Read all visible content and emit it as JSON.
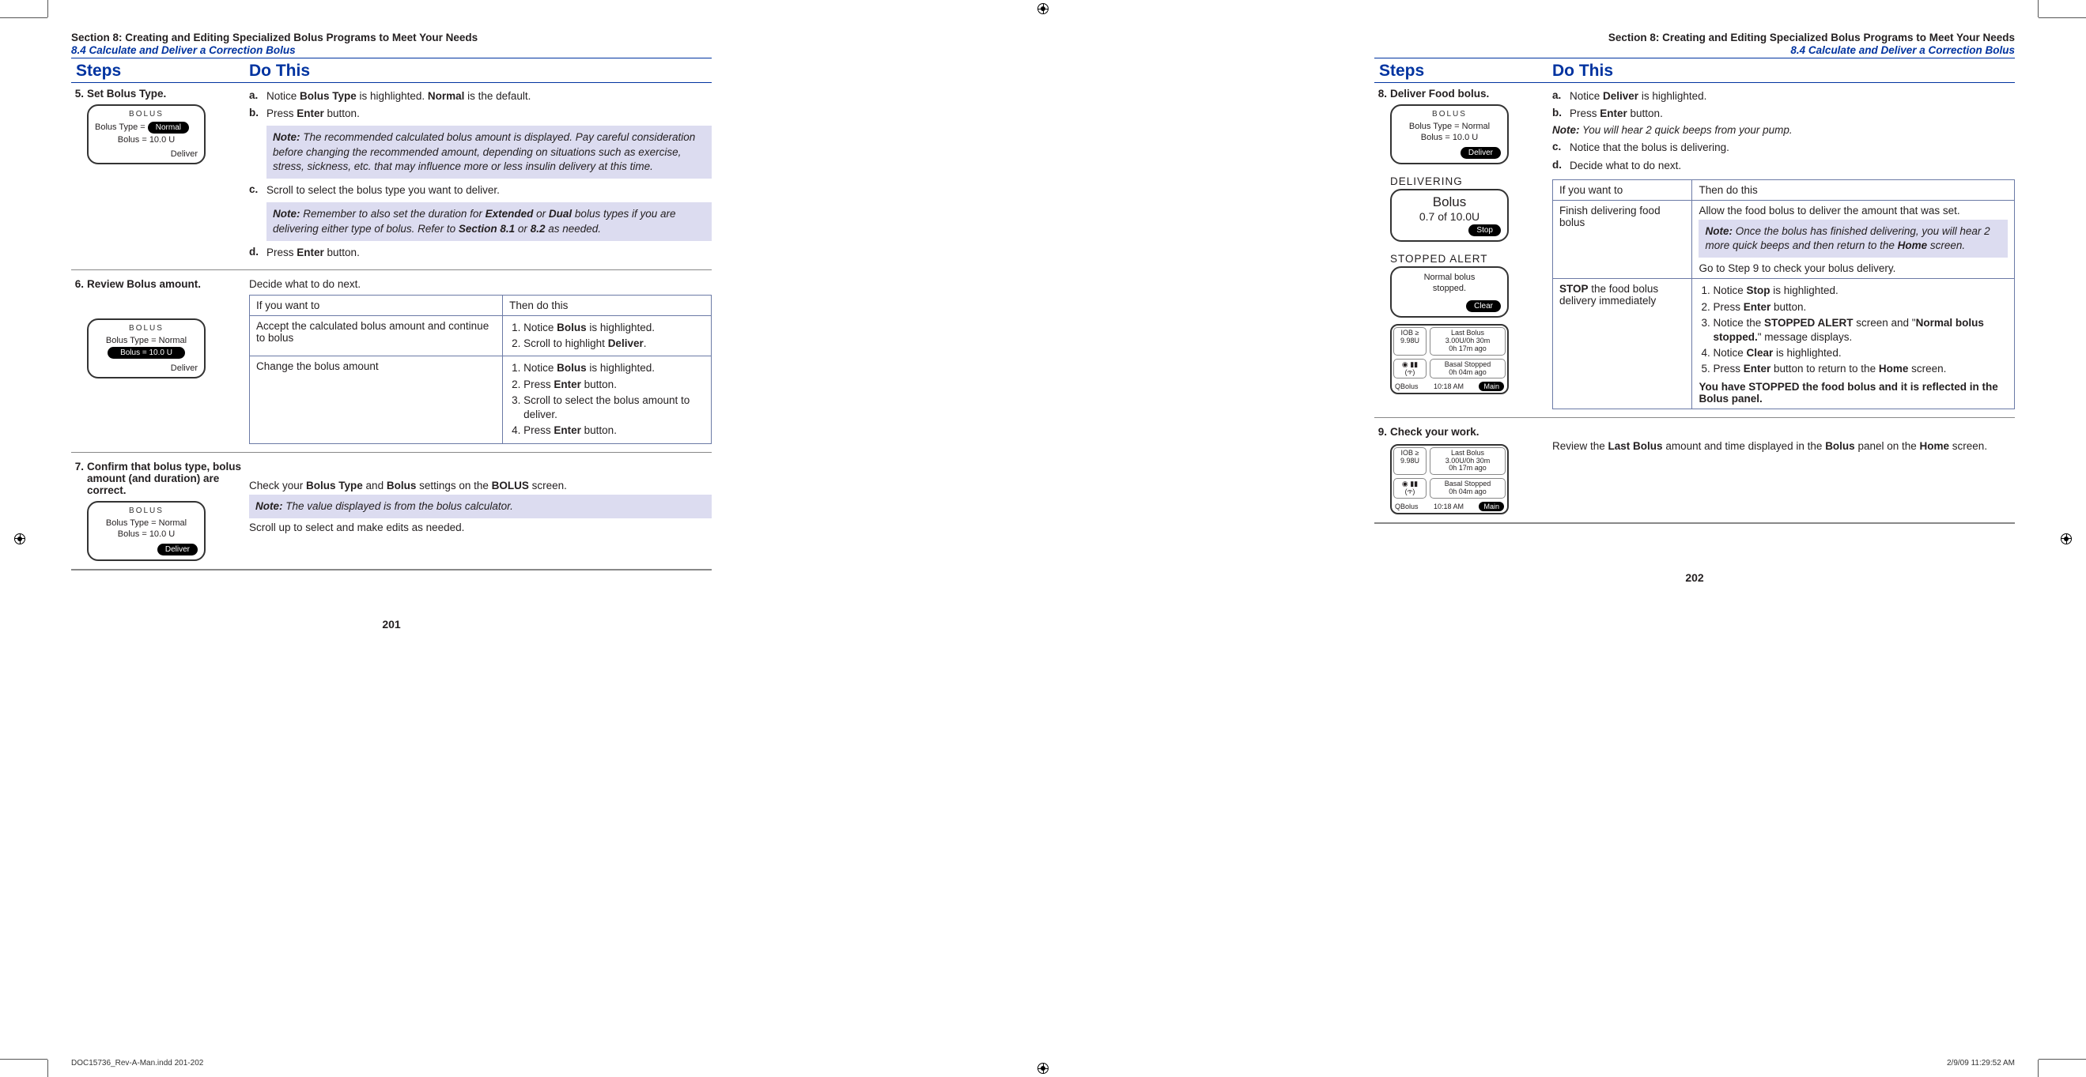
{
  "section_title": "Section 8: Creating and Editing Specialized Bolus Programs to Meet Your Needs",
  "section_sub": "8.4 Calculate and Deliver a Correction Bolus",
  "columns": {
    "steps": "Steps",
    "do_this": "Do This"
  },
  "left": {
    "page_num": "201",
    "step5": {
      "num": "5.",
      "title": "Set Bolus Type.",
      "a": "Notice ",
      "a_b1": "Bolus Type",
      "a_mid": " is highlighted. ",
      "a_b2": "Normal",
      "a_end": " is the default.",
      "b": "Press ",
      "b_b": "Enter",
      "b_end": " button.",
      "note1_lead": "Note:",
      "note1_txt": " The recommended calculated bolus amount is displayed. Pay careful consideration before changing the recommended amount, depending on situations such as exercise, stress, sickness, etc. that may influence more or less insulin delivery at this time.",
      "c": "Scroll to select the bolus type you want to deliver.",
      "note2_lead": "Note:",
      "note2_txt_pre": " Remember to also set the duration for ",
      "note2_b1": "Extended",
      "note2_mid": " or ",
      "note2_b2": "Dual",
      "note2_txt_mid2": " bolus types if you are delivering either type of bolus. Refer to ",
      "note2_b3": "Section 8.1",
      "note2_or": " or ",
      "note2_b4": "8.2",
      "note2_end": " as needed.",
      "d": "Press ",
      "d_b": "Enter",
      "d_end": " button.",
      "screen": {
        "title": "BOLUS",
        "l1a": "Bolus Type = ",
        "l1b_pill": "Normal",
        "l2": "Bolus = 10.0 U",
        "footer": "Deliver"
      }
    },
    "step6": {
      "num": "6.",
      "title": "Review Bolus amount.",
      "intro": "Decide what to do next.",
      "th1": "If you want to",
      "th2": "Then do this",
      "r1c1": "Accept the calculated bolus amount and continue to bolus",
      "r1li1_pre": "Notice ",
      "r1li1_b": "Bolus",
      "r1li1_end": " is highlighted.",
      "r1li2_pre": "Scroll to highlight ",
      "r1li2_b": "Deliver",
      "r1li2_end": ".",
      "r2c1": "Change the bolus amount",
      "r2li1_pre": "Notice ",
      "r2li1_b": "Bolus",
      "r2li1_end": " is highlighted.",
      "r2li2_pre": "Press ",
      "r2li2_b": "Enter",
      "r2li2_end": " button.",
      "r2li3": "Scroll to select the bolus amount to deliver.",
      "r2li4_pre": "Press ",
      "r2li4_b": "Enter",
      "r2li4_end": " button.",
      "screen": {
        "title": "BOLUS",
        "l1": "Bolus Type = Normal",
        "l2_pill": "Bolus = 10.0 U",
        "footer": "Deliver"
      }
    },
    "step7": {
      "num": "7.",
      "title": "Confirm that bolus type, bolus amount (and duration) are correct.",
      "p1_pre": "Check your ",
      "p1_b1": "Bolus Type",
      "p1_mid": " and ",
      "p1_b2": "Bolus",
      "p1_mid2": " settings on the ",
      "p1_b3": "BOLUS",
      "p1_end": " screen.",
      "note_lead": "Note:",
      "note_txt": " The value displayed is from the bolus calculator.",
      "p2": "Scroll up to select and make edits as needed.",
      "screen": {
        "title": "BOLUS",
        "l1": "Bolus Type = Normal",
        "l2": "Bolus = 10.0 U",
        "footer_pill": "Deliver"
      }
    }
  },
  "right": {
    "page_num": "202",
    "step8": {
      "num": "8.",
      "title": "Deliver Food bolus.",
      "a_pre": "Notice ",
      "a_b": "Deliver",
      "a_end": " is highlighted.",
      "b_pre": "Press ",
      "b_b": "Enter",
      "b_end": " button.",
      "noteInline_lead": "Note:",
      "noteInline_txt": " You will hear 2 quick beeps from your pump.",
      "c": "Notice that the bolus is delivering.",
      "d": "Decide what to do next.",
      "th1": "If you want to",
      "th2": "Then do this",
      "r1c1": "Finish delivering food bolus",
      "r1p1": "Allow the food bolus to deliver the amount that was set.",
      "r1note_lead": "Note:",
      "r1note_txt_pre": " Once the bolus has finished delivering, you will hear 2 more quick beeps and then return to the ",
      "r1note_b": "Home",
      "r1note_end": " screen.",
      "r1p2": "Go to Step 9 to check your bolus delivery.",
      "r2c1_b": "STOP",
      "r2c1_rest": " the food bolus delivery immediately",
      "r2li1_pre": "Notice ",
      "r2li1_b": "Stop",
      "r2li1_end": " is highlighted.",
      "r2li2_pre": "Press ",
      "r2li2_b": "Enter",
      "r2li2_end": " button.",
      "r2li3_pre": "Notice the ",
      "r2li3_b1": "STOPPED ALERT",
      "r2li3_mid": " screen and \"",
      "r2li3_b2": "Normal bolus stopped.",
      "r2li3_end": "\" message displays.",
      "r2li4_pre": "Notice ",
      "r2li4_b": "Clear",
      "r2li4_end": " is highlighted.",
      "r2li5_pre": "Press ",
      "r2li5_b": "Enter",
      "r2li5_mid": " button to return to the ",
      "r2li5_b2": "Home",
      "r2li5_end": " screen.",
      "r2foot": "You have STOPPED the food bolus and it is reflected in the Bolus panel.",
      "screen_bolus": {
        "title": "BOLUS",
        "l1": "Bolus Type = Normal",
        "l2": "Bolus = 10.0 U",
        "footer_pill": "Deliver"
      },
      "screen_deliver": {
        "title": "DELIVERING",
        "big": "Bolus",
        "med": "0.7 of 10.0U",
        "footer_pill": "Stop"
      },
      "screen_stopped": {
        "title": "STOPPED ALERT",
        "l1": "Normal bolus",
        "l2": "stopped.",
        "footer_pill": "Clear"
      },
      "home": {
        "iob_lbl": "IOB ≥",
        "iob_val": "9.98U",
        "last_title": "Last Bolus",
        "last_l1": "3.00U/0h 30m",
        "last_l2": "0h 17m ago",
        "basal_title": "Basal Stopped",
        "basal_l1": "0h 04m ago",
        "foot_l": "QBolus",
        "foot_m": "10:18 AM",
        "foot_pill": "Main"
      }
    },
    "step9": {
      "num": "9.",
      "title": "Check your work.",
      "p_pre": "Review the ",
      "p_b1": "Last Bolus",
      "p_mid": " amount and time displayed in the ",
      "p_b2": "Bolus",
      "p_mid2": " panel on the ",
      "p_b3": "Home",
      "p_end": " screen."
    }
  },
  "slug_left": "DOC15736_Rev-A-Man.indd   201-202",
  "slug_right": "2/9/09   11:29:52 AM"
}
